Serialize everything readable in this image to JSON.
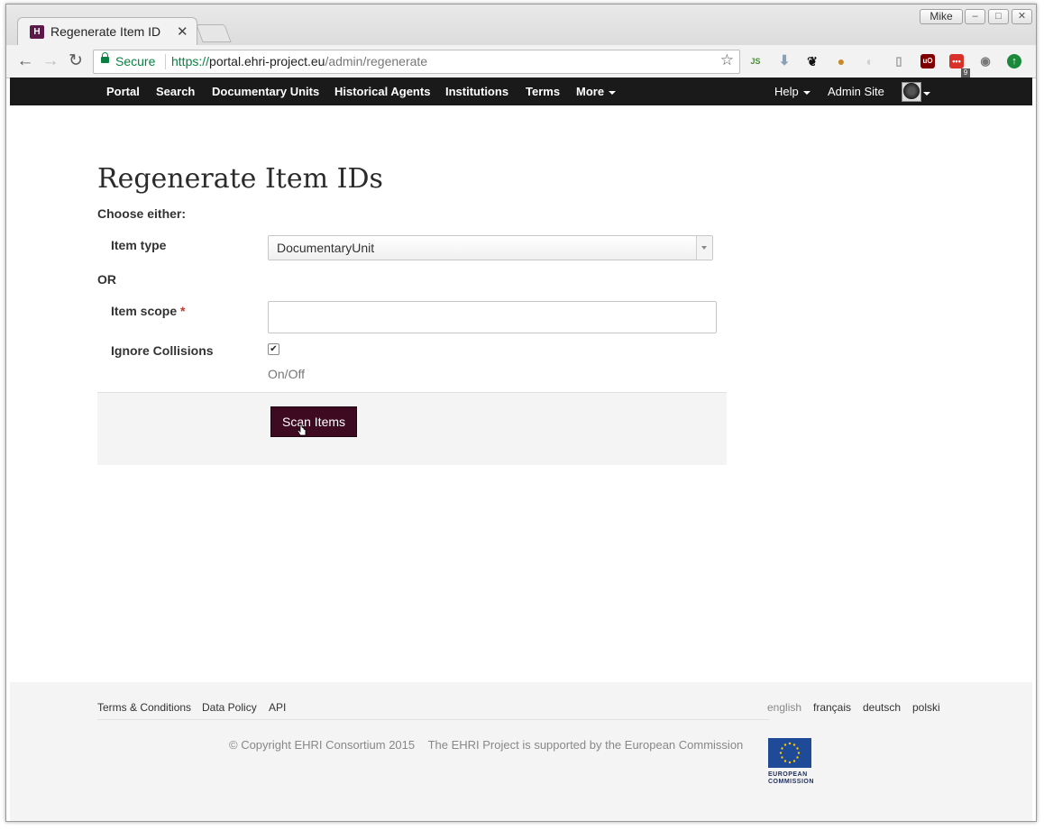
{
  "browser": {
    "tab_title": "Regenerate Item ID",
    "user_name": "Mike",
    "secure_label": "Secure",
    "url_scheme": "https://",
    "url_host": "portal.ehri-project.eu",
    "url_path": "/admin/regenerate",
    "extension_badge": "9"
  },
  "navbar": {
    "items": [
      "Portal",
      "Search",
      "Documentary Units",
      "Historical Agents",
      "Institutions",
      "Terms",
      "More"
    ],
    "help": "Help",
    "admin_site": "Admin Site"
  },
  "page": {
    "title": "Regenerate Item IDs",
    "choose_either": "Choose either:",
    "item_type_label": "Item type",
    "item_type_value": "DocumentaryUnit",
    "or_label": "OR",
    "item_scope_label": "Item scope",
    "required_mark": "*",
    "item_scope_value": "",
    "ignore_collisions_label": "Ignore Collisions",
    "ignore_collisions_checked": true,
    "ignore_collisions_help": "On/Off",
    "scan_button": "Scan Items"
  },
  "footer": {
    "links": [
      "Terms & Conditions",
      "Data Policy",
      "API"
    ],
    "languages": [
      "english",
      "français",
      "deutsch",
      "polski"
    ],
    "copyright": "© Copyright EHRI Consortium 2015",
    "support": "The EHRI Project is supported by the European Commission",
    "eu_logo_text": "EUROPEAN COMMISSION"
  },
  "colors": {
    "navbar_bg": "#1a1a1a",
    "button_bg": "#3e0a22",
    "secure_green": "#0b8043",
    "eu_blue": "#1e4a98"
  }
}
